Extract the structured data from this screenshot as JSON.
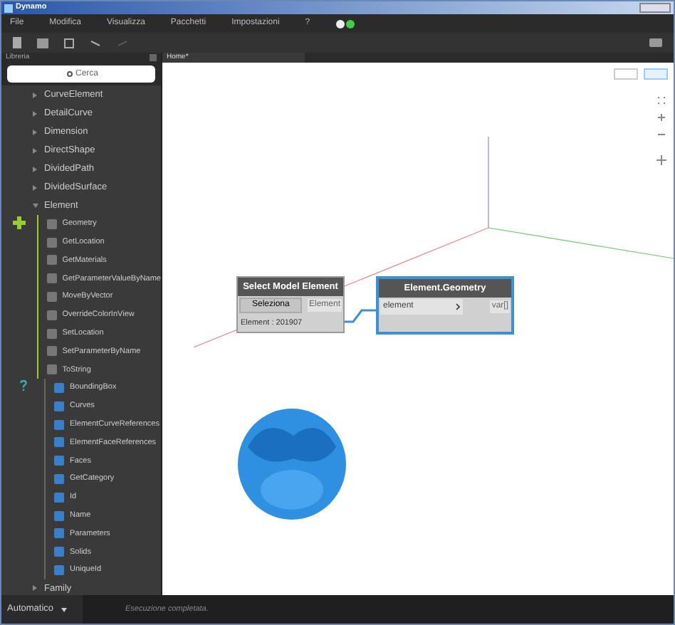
{
  "window": {
    "title": "Dynamo"
  },
  "menu": [
    "File",
    "Modifica",
    "Visualizza",
    "Pacchetti",
    "Impostazioni",
    "?"
  ],
  "library": {
    "title": "Libreria",
    "search": {
      "placeholder": "Cerca"
    },
    "items": [
      {
        "label": "CurveElement",
        "expanded": false
      },
      {
        "label": "DetailCurve",
        "expanded": false
      },
      {
        "label": "Dimension",
        "expanded": false
      },
      {
        "label": "DirectShape",
        "expanded": false
      },
      {
        "label": "DividedPath",
        "expanded": false
      },
      {
        "label": "DividedSurface",
        "expanded": false
      },
      {
        "label": "Element",
        "expanded": true,
        "groups": [
          {
            "kind": "action",
            "children": [
              "Geometry",
              "GetLocation",
              "GetMaterials",
              "GetParameterValueByName",
              "MoveByVector",
              "OverrideColorInView",
              "SetLocation",
              "SetParameterByName",
              "ToString"
            ]
          },
          {
            "kind": "query",
            "children": [
              "BoundingBox",
              "Curves",
              "ElementCurveReferences",
              "ElementFaceReferences",
              "Faces",
              "GetCategory",
              "Id",
              "Name",
              "Parameters",
              "Solids",
              "UniqueId"
            ]
          }
        ]
      },
      {
        "label": "Family",
        "expanded": false
      }
    ]
  },
  "tab": {
    "label": "Home*",
    "selected": true
  },
  "canvas": {
    "nodes": [
      {
        "title": "Select Model Element",
        "button": "Seleziona",
        "output": "Element",
        "footer": "Element : 201907",
        "selected": false
      },
      {
        "title": "Element.Geometry",
        "input": "element",
        "output": "var[]",
        "selected": true
      }
    ]
  },
  "status_bar": {
    "run_mode": "Automatico",
    "message": "Esecuzione completata."
  }
}
